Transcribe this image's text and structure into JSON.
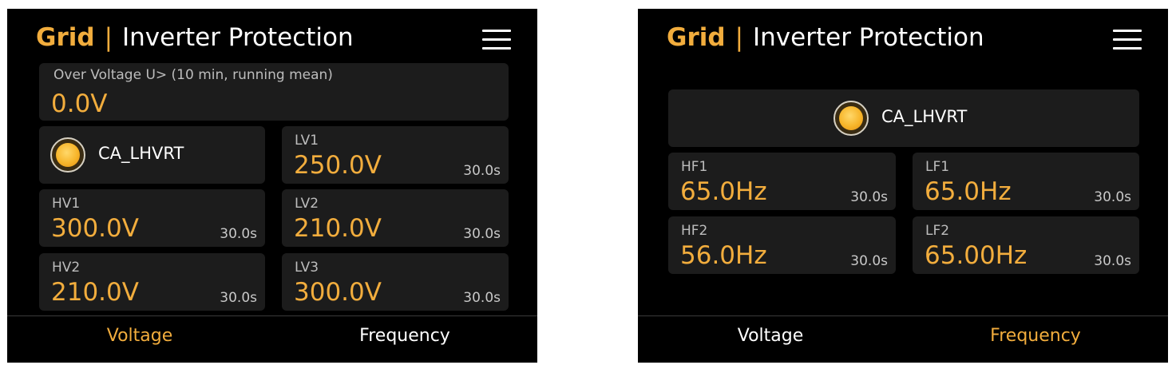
{
  "colors": {
    "accent": "#f2ad3d",
    "background": "#000000",
    "card": "#1c1c1c",
    "text": "#ffffff"
  },
  "voltage_screen": {
    "title": {
      "brand": "Grid",
      "separator": "|",
      "name": "Inverter Protection"
    },
    "menu_icon": "hamburger-menu-icon",
    "over_voltage": {
      "label": "Over Voltage U> (10 min, running mean)",
      "value": "0.0V"
    },
    "profile": {
      "icon": "status-lamp-icon",
      "name": "CA_LHVRT"
    },
    "cards": {
      "lv1": {
        "label": "LV1",
        "value": "250.0V",
        "time": "30.0s"
      },
      "hv1": {
        "label": "HV1",
        "value": "300.0V",
        "time": "30.0s"
      },
      "lv2": {
        "label": "LV2",
        "value": "210.0V",
        "time": "30.0s"
      },
      "hv2": {
        "label": "HV2",
        "value": "210.0V",
        "time": "30.0s"
      },
      "lv3": {
        "label": "LV3",
        "value": "300.0V",
        "time": "30.0s"
      }
    },
    "tabs": {
      "voltage": "Voltage",
      "frequency": "Frequency",
      "active": "voltage"
    }
  },
  "frequency_screen": {
    "title": {
      "brand": "Grid",
      "separator": "|",
      "name": "Inverter Protection"
    },
    "menu_icon": "hamburger-menu-icon",
    "profile": {
      "icon": "status-lamp-icon",
      "name": "CA_LHVRT"
    },
    "cards": {
      "hf1": {
        "label": "HF1",
        "value": "65.0Hz",
        "time": "30.0s"
      },
      "lf1": {
        "label": "LF1",
        "value": "65.0Hz",
        "time": "30.0s"
      },
      "hf2": {
        "label": "HF2",
        "value": "56.0Hz",
        "time": "30.0s"
      },
      "lf2": {
        "label": "LF2",
        "value": "65.00Hz",
        "time": "30.0s"
      }
    },
    "tabs": {
      "voltage": "Voltage",
      "frequency": "Frequency",
      "active": "frequency"
    }
  }
}
